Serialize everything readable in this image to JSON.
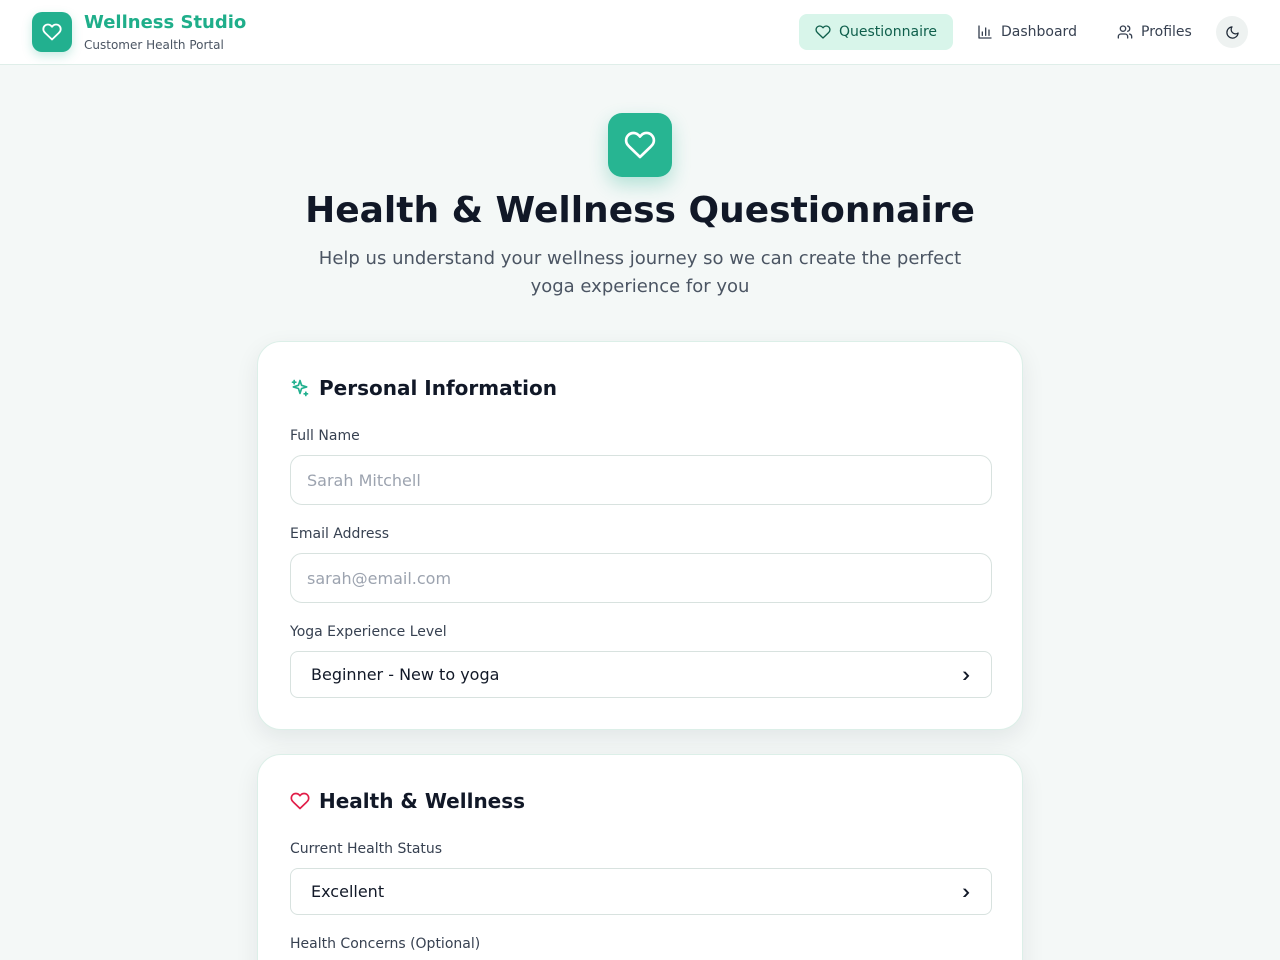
{
  "header": {
    "brand_title": "Wellness Studio",
    "brand_subtitle": "Customer Health Portal",
    "nav": [
      {
        "label": "Questionnaire",
        "icon": "heart-icon",
        "active": true
      },
      {
        "label": "Dashboard",
        "icon": "bar-chart-icon",
        "active": false
      },
      {
        "label": "Profiles",
        "icon": "users-icon",
        "active": false
      }
    ],
    "theme_toggle_icon": "moon-icon"
  },
  "hero": {
    "icon": "heart-icon",
    "title": "Health & Wellness Questionnaire",
    "subtitle": "Help us understand your wellness journey so we can create the perfect yoga experience for you"
  },
  "personal_info": {
    "heading": "Personal Information",
    "heading_icon": "sparkles-icon",
    "full_name": {
      "label": "Full Name",
      "placeholder": "Sarah Mitchell"
    },
    "email": {
      "label": "Email Address",
      "placeholder": "sarah@email.com"
    },
    "experience": {
      "label": "Yoga Experience Level",
      "selected": "Beginner - New to yoga"
    }
  },
  "health": {
    "heading": "Health & Wellness",
    "heading_icon": "heart-outline-icon",
    "status": {
      "label": "Current Health Status",
      "selected": "Excellent"
    },
    "concerns": {
      "label": "Health Concerns (Optional)"
    }
  },
  "colors": {
    "accent": "#22b08f",
    "accent_soft": "#d8f5ea",
    "heart_red": "#e11d48",
    "background": "#f4f8f7"
  }
}
